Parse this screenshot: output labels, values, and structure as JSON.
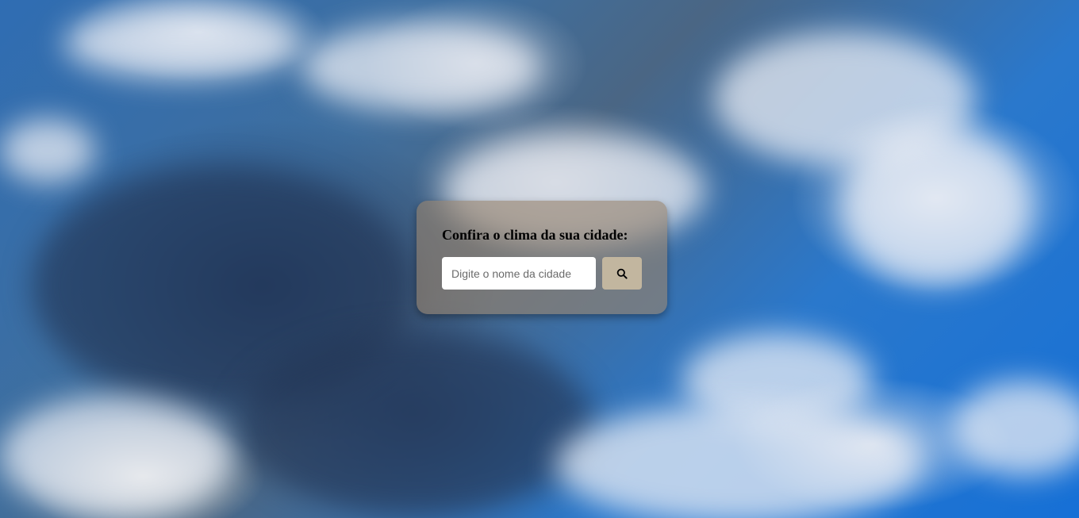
{
  "background": {
    "description_icon": "cloudy-sky-background"
  },
  "card": {
    "title": "Confira o clima da sua cidade:",
    "background_color": "#96826e",
    "search": {
      "placeholder": "Digite o nome da cidade",
      "value": ""
    },
    "search_button": {
      "icon": "search-icon",
      "background_color": "#c2b69f"
    }
  }
}
